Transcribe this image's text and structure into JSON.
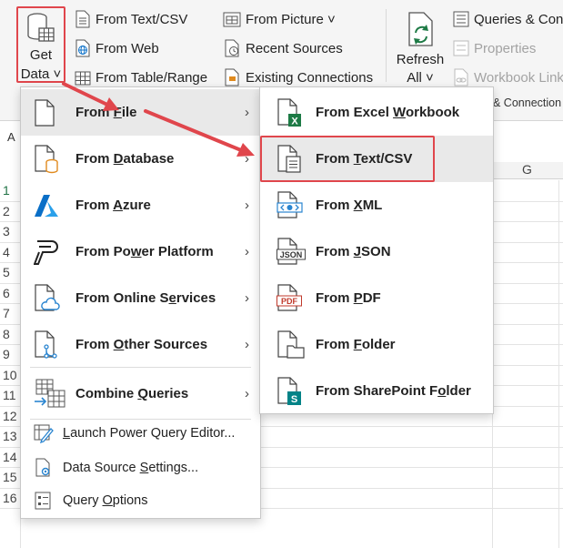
{
  "ribbon": {
    "get_data": {
      "line1": "Get",
      "line2": "Data ˅"
    },
    "from_text_csv": "From Text/CSV",
    "from_web": "From Web",
    "from_table_range": "From Table/Range",
    "from_picture": "From Picture ˅",
    "recent_sources": "Recent Sources",
    "existing_connections": "Existing Connections",
    "refresh_all": {
      "line1": "Refresh",
      "line2": "All ˅"
    },
    "queries_connections": "Queries & Con",
    "properties": "Properties",
    "workbook_links": "Workbook Link",
    "group_label": "& Connection"
  },
  "sheet": {
    "namebox": "A",
    "column_g": "G",
    "rows": [
      "1",
      "2",
      "3",
      "4",
      "5",
      "6",
      "7",
      "8",
      "9",
      "10",
      "11",
      "12",
      "13",
      "14",
      "15",
      "16"
    ]
  },
  "menu1": {
    "from_file": {
      "pre": "From ",
      "u": "F",
      "post": "ile",
      "arrow": "›"
    },
    "from_database": {
      "pre": "From ",
      "u": "D",
      "post": "atabase",
      "arrow": "›"
    },
    "from_azure": {
      "pre": "From ",
      "u": "A",
      "post": "zure",
      "arrow": "›"
    },
    "from_power_platform": {
      "pre": "From Po",
      "u": "w",
      "post": "er Platform",
      "arrow": "›"
    },
    "from_online_services": {
      "pre": "From Online S",
      "u": "e",
      "post": "rvices",
      "arrow": "›"
    },
    "from_other_sources": {
      "pre": "From ",
      "u": "O",
      "post": "ther Sources",
      "arrow": "›"
    },
    "combine_queries": {
      "pre": "Combine ",
      "u": "Q",
      "post": "ueries",
      "arrow": "›"
    },
    "launch_pq_editor": {
      "pre": "",
      "u": "L",
      "post": "aunch Power Query Editor..."
    },
    "data_source_settings": {
      "pre": "Data Source ",
      "u": "S",
      "post": "ettings..."
    },
    "query_options": {
      "pre": "Query ",
      "u": "O",
      "post": "ptions"
    }
  },
  "menu2": {
    "excel_workbook": {
      "pre": "From Excel ",
      "u": "W",
      "post": "orkbook"
    },
    "text_csv": {
      "pre": "From ",
      "u": "T",
      "post": "ext/CSV"
    },
    "xml": {
      "pre": "From ",
      "u": "X",
      "post": "ML"
    },
    "json": {
      "pre": "From ",
      "u": "J",
      "post": "SON"
    },
    "pdf": {
      "pre": "From ",
      "u": "P",
      "post": "DF"
    },
    "folder": {
      "pre": "From ",
      "u": "F",
      "post": "older"
    },
    "sharepoint_folder": {
      "pre": "From SharePoint F",
      "u": "o",
      "post": "lder"
    },
    "json_icon_text": "JSON",
    "pdf_icon_text": "PDF",
    "excel_icon_text": "X",
    "sharepoint_icon_text": "S"
  },
  "colors": {
    "highlight": "#e0464c",
    "excel_green": "#1d7a45",
    "azure_blue": "#0a6fc7",
    "sharepoint_teal": "#038387",
    "pdf_red": "#c0392b",
    "database_orange": "#e08a1e"
  }
}
